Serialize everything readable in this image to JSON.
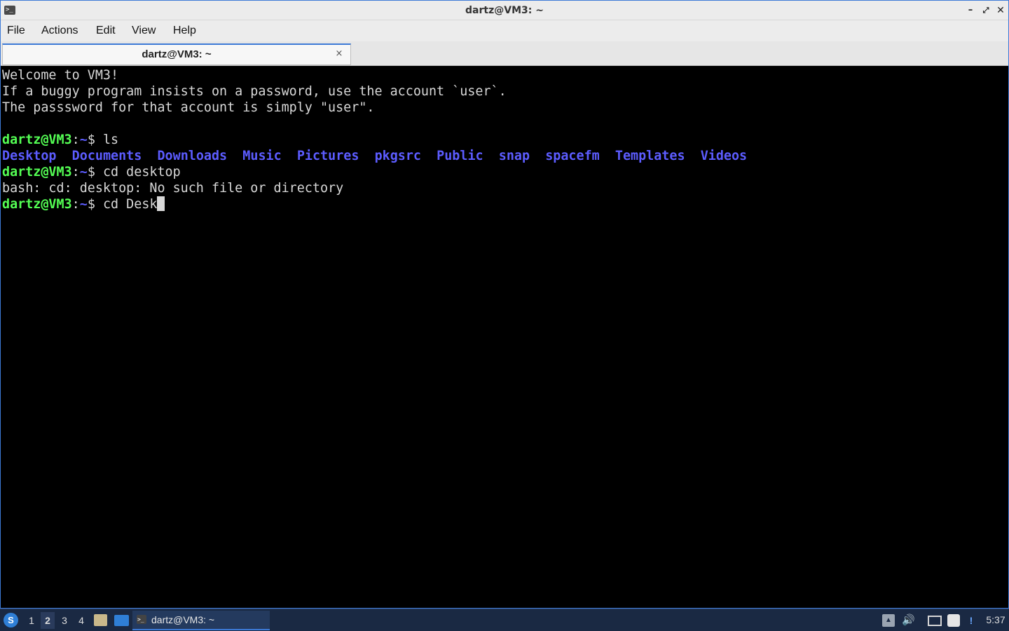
{
  "window": {
    "title": "dartz@VM3: ~",
    "min_glyph": "–",
    "max_glyph": "⤢",
    "close_glyph": "✕",
    "app_icon_glyph": ">_"
  },
  "menu": {
    "file": "File",
    "actions": "Actions",
    "edit": "Edit",
    "view": "View",
    "help": "Help"
  },
  "tab": {
    "label": "dartz@VM3: ~",
    "close_glyph": "×"
  },
  "terminal": {
    "welcome": [
      "Welcome to VM3!",
      "If a buggy program insists on a password, use the account `user`.",
      "The passsword for that account is simply \"user\"."
    ],
    "prompt_user": "dartz@VM3",
    "prompt_sep": ":",
    "prompt_path": "~",
    "prompt_dollar": "$ ",
    "cmd1": "ls",
    "dirs": [
      "Desktop",
      "Documents",
      "Downloads",
      "Music",
      "Pictures",
      "pkgsrc",
      "Public",
      "snap",
      "spacefm",
      "Templates",
      "Videos"
    ],
    "cmd2": "cd desktop",
    "error": "bash: cd: desktop: No such file or directory",
    "cmd3": "cd Desk"
  },
  "taskbar": {
    "workspaces": [
      "1",
      "2",
      "3",
      "4"
    ],
    "active_task": "dartz@VM3: ~",
    "task_icon_glyph": ">_",
    "clock": "5:37",
    "start_glyph": "S",
    "tray_up_glyph": "▲",
    "volume_glyph": "🔊",
    "notify_glyph": "!"
  },
  "colors": {
    "accent": "#3d7ad6",
    "prompt_user": "#54ff54",
    "dir": "#5c5cff"
  }
}
